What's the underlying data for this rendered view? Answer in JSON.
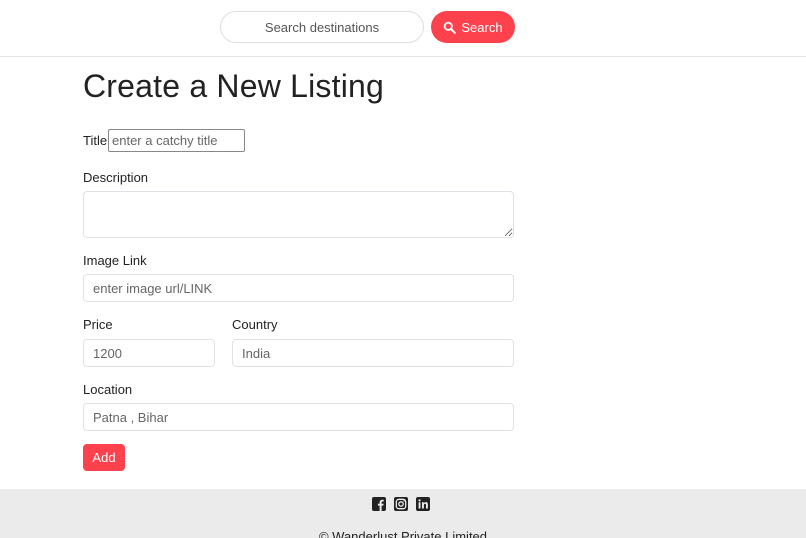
{
  "navbar": {
    "search_placeholder": "Search destinations",
    "search_button_label": "Search",
    "accent_color": "#fe424d"
  },
  "form": {
    "heading": "Create a New Listing",
    "title_label": "Title",
    "title_placeholder": "enter a catchy title",
    "description_label": "Description",
    "description_value": "",
    "image_label": "Image Link",
    "image_placeholder": "enter image url/LINK",
    "price_label": "Price",
    "price_placeholder": "1200",
    "country_label": "Country",
    "country_placeholder": "India",
    "location_label": "Location",
    "location_placeholder": "Patna , Bihar",
    "submit_label": "Add"
  },
  "footer": {
    "icons": [
      "facebook-icon",
      "instagram-icon",
      "linkedin-icon"
    ],
    "copyright": "© Wanderlust Private Limited"
  }
}
